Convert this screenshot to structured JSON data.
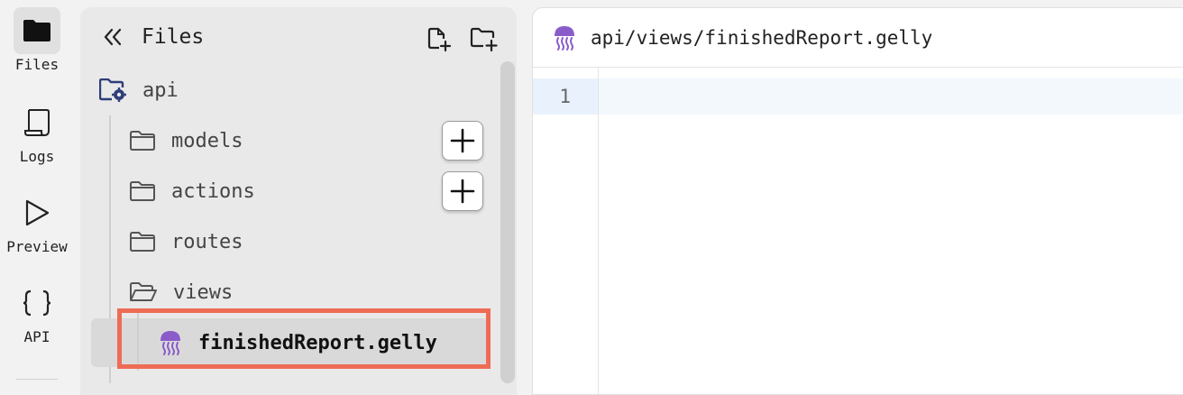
{
  "rail": {
    "items": [
      {
        "label": "Files",
        "icon": "folder-icon",
        "active": true
      },
      {
        "label": "Logs",
        "icon": "scroll-icon",
        "active": false
      },
      {
        "label": "Preview",
        "icon": "play-icon",
        "active": false
      },
      {
        "label": "API",
        "icon": "braces-icon",
        "active": false
      }
    ]
  },
  "panel": {
    "title": "Files",
    "new_file_icon": "file-plus-icon",
    "new_folder_icon": "folder-plus-icon",
    "collapse_icon": "double-chevron-left-icon"
  },
  "tree": {
    "root": {
      "label": "api",
      "icon": "folder-gear-icon"
    },
    "folders": [
      {
        "label": "models",
        "icon": "folder-icon",
        "open": false
      },
      {
        "label": "actions",
        "icon": "folder-icon",
        "open": false
      },
      {
        "label": "routes",
        "icon": "folder-icon",
        "open": false
      },
      {
        "label": "views",
        "icon": "folder-open-icon",
        "open": true
      }
    ],
    "selected_file": {
      "label": "finishedReport.gelly",
      "icon": "jellyfish-icon"
    }
  },
  "editor": {
    "tab_path": "api/views/finishedReport.gelly",
    "line_numbers": [
      "1"
    ]
  },
  "colors": {
    "highlight": "#ee6c56",
    "gelly_icon": "#8a5cc9",
    "root_folder_icon": "#2f3d7a"
  }
}
